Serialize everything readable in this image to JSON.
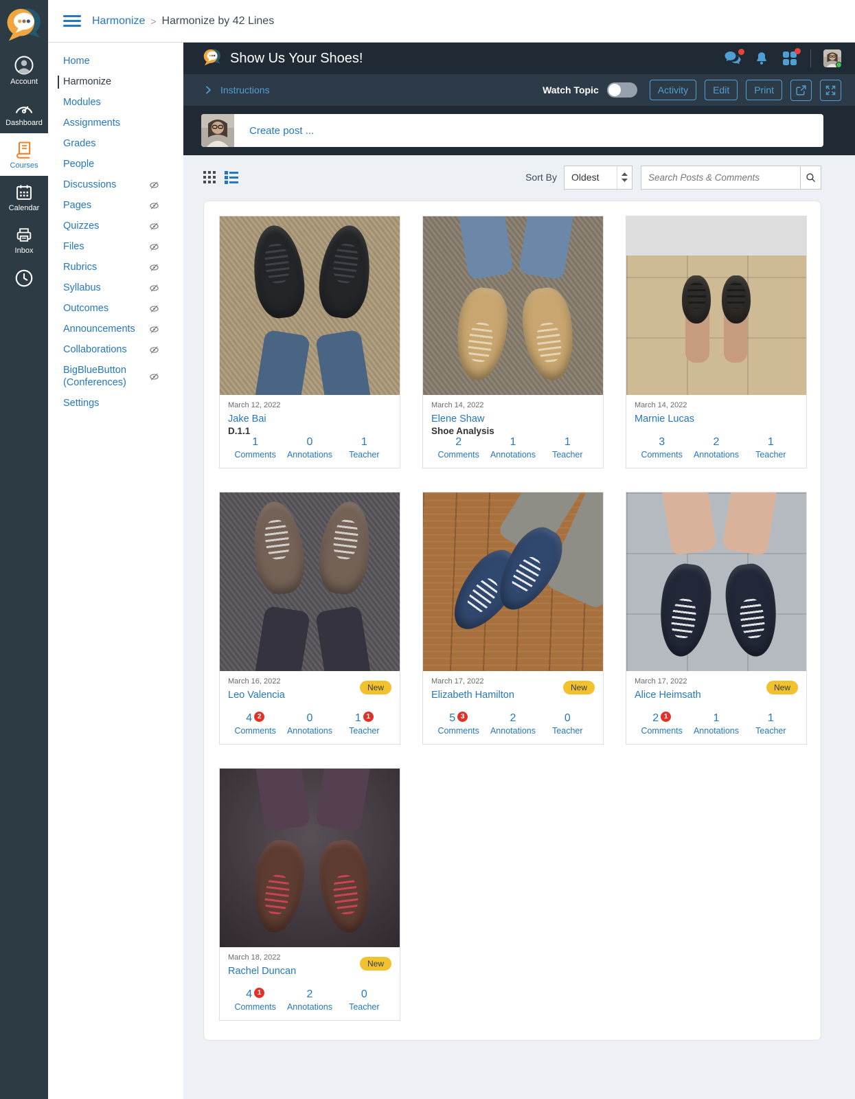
{
  "colors": {
    "accent": "#4f9fd4",
    "link": "#2578be",
    "header_dark": "#1f2a35",
    "toolbar_dark": "#2d3b49",
    "rail": "#2d3b45",
    "page_bg": "#edf0f5",
    "new": "#f2c12e",
    "red": "#df332a",
    "orange": "#ef8226",
    "green": "#43c14b"
  },
  "global_nav": {
    "items": [
      {
        "label": "Account"
      },
      {
        "label": "Dashboard"
      },
      {
        "label": "Courses",
        "active": true
      },
      {
        "label": "Calendar"
      },
      {
        "label": "Inbox"
      }
    ]
  },
  "breadcrumb": {
    "course": "Harmonize",
    "separator": ">",
    "page": "Harmonize by 42 Lines"
  },
  "course_nav": {
    "items": [
      {
        "label": "Home"
      },
      {
        "label": "Harmonize",
        "active": true
      },
      {
        "label": "Modules"
      },
      {
        "label": "Assignments"
      },
      {
        "label": "Grades"
      },
      {
        "label": "People"
      },
      {
        "label": "Discussions",
        "hidden_icon": true
      },
      {
        "label": "Pages",
        "hidden_icon": true
      },
      {
        "label": "Quizzes",
        "hidden_icon": true
      },
      {
        "label": "Files",
        "hidden_icon": true
      },
      {
        "label": "Rubrics",
        "hidden_icon": true
      },
      {
        "label": "Syllabus",
        "hidden_icon": true
      },
      {
        "label": "Outcomes",
        "hidden_icon": true
      },
      {
        "label": "Announcements",
        "hidden_icon": true
      },
      {
        "label": "Collaborations",
        "hidden_icon": true
      },
      {
        "label": "BigBlueButton (Conferences)",
        "hidden_icon": true
      },
      {
        "label": "Settings"
      }
    ]
  },
  "topic_header": {
    "title": "Show Us Your Shoes!"
  },
  "toolbar": {
    "instructions_label": "Instructions",
    "watch_topic_label": "Watch Topic",
    "watch_topic_state": "off",
    "activity_label": "Activity",
    "edit_label": "Edit",
    "print_label": "Print"
  },
  "composer": {
    "prompt": "Create post ..."
  },
  "controls": {
    "sort_by_label": "Sort By",
    "sort_value": "Oldest",
    "search_placeholder": "Search Posts & Comments"
  },
  "stats_labels": {
    "comments": "Comments",
    "annotations": "Annotations",
    "teacher": "Teacher"
  },
  "new_badge_label": "New",
  "posts": [
    {
      "date": "March 12, 2022",
      "author": "Jake Bai",
      "title": "D.1.1",
      "comments": "1",
      "annotations": "0",
      "teacher": "1",
      "image": {
        "alt": "black sneakers on tan carpet",
        "floor": "#ab9979",
        "leg": "#4a6584",
        "shoe": "#232528",
        "lace": "#3f4348"
      }
    },
    {
      "date": "March 14, 2022",
      "author": "Elene Shaw",
      "title": "Shoe Analysis",
      "comments": "2",
      "annotations": "1",
      "teacher": "1",
      "image": {
        "alt": "tan boots on gray carpet",
        "floor": "#877d6e",
        "leg": "#6b88a8",
        "shoe": "#c9a670",
        "lace": "#e3d7b8"
      }
    },
    {
      "date": "March 14, 2022",
      "author": "Marnie Lucas",
      "comments": "3",
      "annotations": "2",
      "teacher": "1",
      "image": {
        "alt": "black sandals on beige tile",
        "floor": "#cfba96",
        "leg": "#c79b7e",
        "shoe": "#2e2b28",
        "lace": "#1c1a18",
        "bars": "#dedede"
      }
    },
    {
      "date": "March 16, 2022",
      "author": "Leo Valencia",
      "new": true,
      "comments": "4",
      "comments_badge": "2",
      "annotations": "0",
      "teacher": "1",
      "teacher_badge": "1",
      "image": {
        "alt": "brown-gray shoes on dark carpet",
        "floor": "#57555a",
        "leg": "#35333d",
        "shoe": "#756257",
        "lace": "#d8d4cf"
      }
    },
    {
      "date": "March 17, 2022",
      "author": "Elizabeth Hamilton",
      "new": true,
      "comments": "5",
      "comments_badge": "3",
      "annotations": "2",
      "teacher": "0",
      "image": {
        "alt": "navy sneakers on wood floor",
        "floor": "#a8703c",
        "leg": "#8e8d86",
        "shoe": "#31486e",
        "lace": "#f2f2f2"
      }
    },
    {
      "date": "March 17, 2022",
      "author": "Alice Heimsath",
      "new": true,
      "comments": "2",
      "comments_badge": "1",
      "annotations": "1",
      "teacher": "1",
      "image": {
        "alt": "black high-top sneakers on gray tile",
        "floor": "#b4bac0",
        "leg": "#d8b29a",
        "shoe": "#232838",
        "lace": "#ececec"
      }
    },
    {
      "date": "March 18, 2022",
      "author": "Rachel Duncan",
      "new": true,
      "comments": "4",
      "comments_badge": "1",
      "annotations": "2",
      "teacher": "0",
      "image": {
        "alt": "brown boots with red laces",
        "floor": "#463b44",
        "leg": "#54404e",
        "shoe": "#5e3c32",
        "lace": "#cc4455"
      }
    }
  ]
}
